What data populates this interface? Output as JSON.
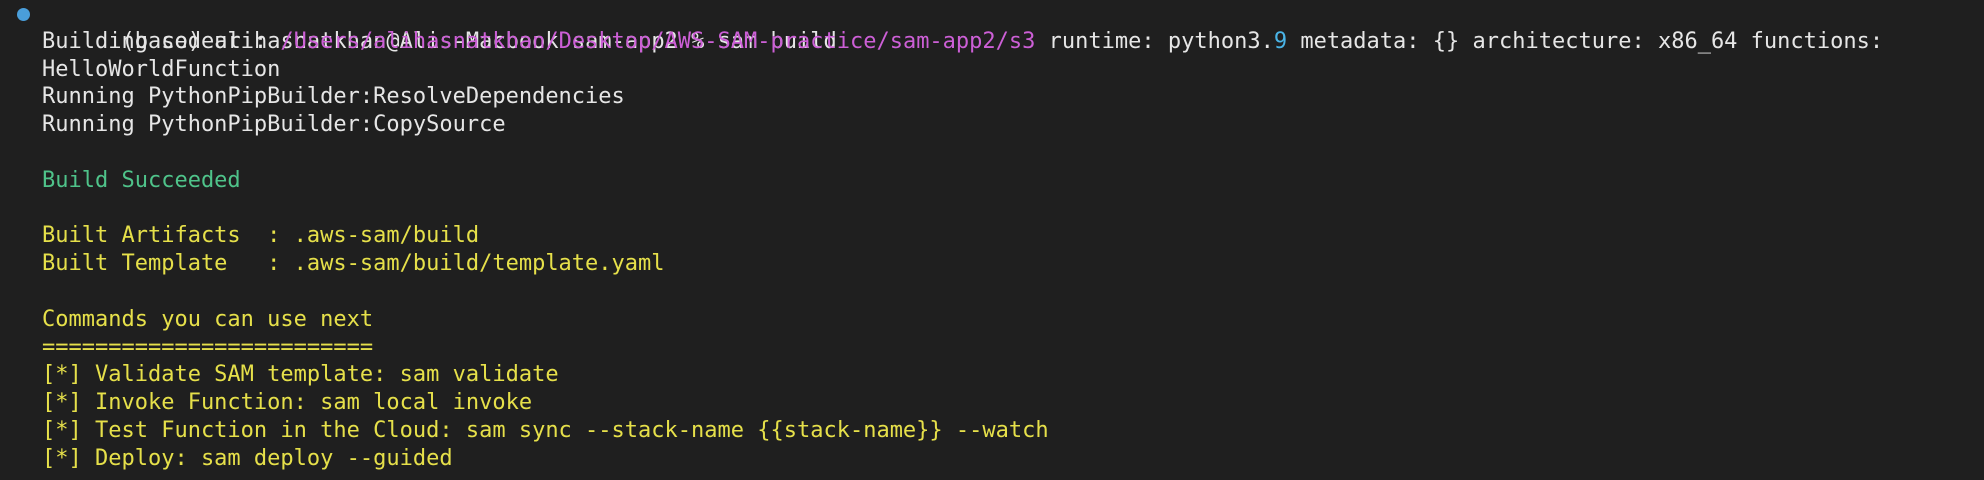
{
  "prompt": {
    "env": "(base)",
    "user_host": "alihasnatkhan@Alis-Macbook",
    "cwd": "sam-app2",
    "symbol": "%",
    "command": "sam build"
  },
  "building": {
    "prefix": "Building codeuri: ",
    "path": "/Users/alihasnatkhan/Desktop/AWS-SAM-practice/sam-app2/s3",
    "runtime_label": " runtime: python3.",
    "runtime_minor": "9",
    "metadata_label": " metadata: ",
    "metadata_value": "{}",
    "arch_label": " architecture: x86_64 functions:",
    "function_name": "HelloWorldFunction"
  },
  "steps": [
    "Running PythonPipBuilder:ResolveDependencies",
    "Running PythonPipBuilder:CopySource"
  ],
  "status": "Build Succeeded",
  "artifacts": [
    "Built Artifacts  : .aws-sam/build",
    "Built Template   : .aws-sam/build/template.yaml"
  ],
  "next_header": "Commands you can use next",
  "divider": "=========================",
  "commands": [
    "[*] Validate SAM template: sam validate",
    "[*] Invoke Function: sam local invoke",
    "[*] Test Function in the Cloud: sam sync --stack-name {{stack-name}} --watch",
    "[*] Deploy: sam deploy --guided"
  ],
  "colors": {
    "background": "#1f1f1f",
    "text": "#e6e6e6",
    "path": "#cc5fd6",
    "number": "#4ab4e6",
    "success": "#4fc38a",
    "info": "#e6e04a",
    "prompt_dot": "#4a9eda"
  },
  "icons": {
    "prompt_marker": "dot-icon"
  }
}
